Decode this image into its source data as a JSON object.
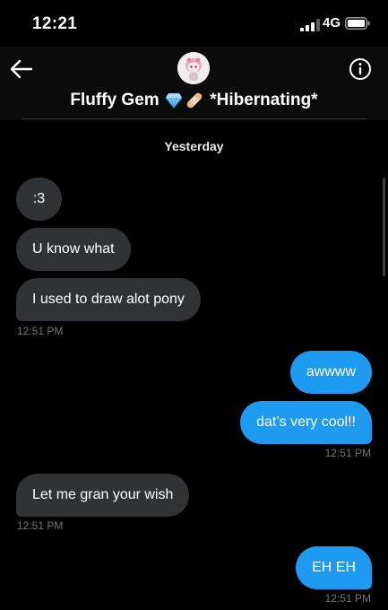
{
  "status_bar": {
    "time": "12:21",
    "network": "4G"
  },
  "header": {
    "name": "Fluffy Gem",
    "name_suffix": "*Hibernating*"
  },
  "thread": {
    "day_label": "Yesterday",
    "messages": [
      {
        "text": ":3",
        "direction": "incoming"
      },
      {
        "text": "U know what",
        "direction": "incoming"
      },
      {
        "text": "I used to draw alot pony",
        "direction": "incoming"
      },
      {
        "text": "awwww",
        "direction": "outgoing"
      },
      {
        "text": "dat’s very cool!!",
        "direction": "outgoing"
      },
      {
        "text": "Let me gran your wish",
        "direction": "incoming"
      },
      {
        "text": "EH EH",
        "direction": "outgoing"
      }
    ],
    "timestamps": [
      "12:51 PM",
      "12:51 PM",
      "12:51 PM",
      "12:51 PM"
    ]
  },
  "icons": {
    "back": "arrow-left-icon",
    "info": "info-circle-icon",
    "signal": "cellular-signal-icon",
    "battery": "battery-icon",
    "gem": "gem-emoji-icon",
    "bandage": "bandage-emoji-icon"
  },
  "colors": {
    "background": "#000000",
    "incoming_bubble": "#2f3336",
    "outgoing_bubble": "#1d9bf0",
    "timestamp": "#71767b"
  }
}
